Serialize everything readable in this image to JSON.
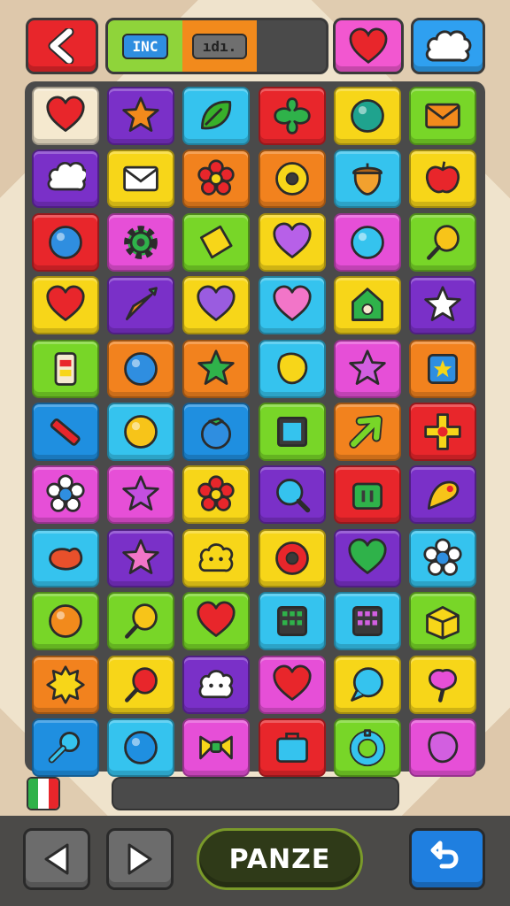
{
  "top_bar": {
    "tab_a_label": "INC",
    "tab_b_label": "ıdı."
  },
  "colors": {
    "red": "#e8262b",
    "orange": "#f2821e",
    "yellow": "#f7d619",
    "green": "#78d628",
    "cyan": "#35c3ee",
    "blue": "#1f8fe0",
    "purple": "#7a30c8",
    "magenta": "#e64fd7",
    "cream": "#f5e9cf"
  },
  "tiles": [
    {
      "bg": "cream",
      "icon": "heart",
      "c": "#e8262b"
    },
    {
      "bg": "purple",
      "icon": "star",
      "c": "#f28a1c"
    },
    {
      "bg": "cyan",
      "icon": "leaf",
      "c": "#38b02a"
    },
    {
      "bg": "red",
      "icon": "clover",
      "c": "#2fb24a"
    },
    {
      "bg": "yellow",
      "icon": "orb",
      "c": "#1fa38e"
    },
    {
      "bg": "green",
      "icon": "envelope",
      "c": "#f28a1c"
    },
    {
      "bg": "purple",
      "icon": "cloud",
      "c": "#ffffff"
    },
    {
      "bg": "yellow",
      "icon": "envelope",
      "c": "#ffffff"
    },
    {
      "bg": "orange",
      "icon": "flower",
      "c": "#e8262b"
    },
    {
      "bg": "orange",
      "icon": "donut",
      "c": "#f7d619"
    },
    {
      "bg": "cyan",
      "icon": "acorn",
      "c": "#f2a12e"
    },
    {
      "bg": "yellow",
      "icon": "apple",
      "c": "#e8262b"
    },
    {
      "bg": "red",
      "icon": "orb",
      "c": "#2f8ee0"
    },
    {
      "bg": "magenta",
      "icon": "gear",
      "c": "#2fb24a"
    },
    {
      "bg": "green",
      "icon": "diamond",
      "c": "#f7d619"
    },
    {
      "bg": "yellow",
      "icon": "heart",
      "c": "#b760e8"
    },
    {
      "bg": "magenta",
      "icon": "orb",
      "c": "#35c3ee"
    },
    {
      "bg": "green",
      "icon": "balloon",
      "c": "#f7c419"
    },
    {
      "bg": "yellow",
      "icon": "heart",
      "c": "#e8262b"
    },
    {
      "bg": "purple",
      "icon": "carrot",
      "c": "#f28a1c"
    },
    {
      "bg": "yellow",
      "icon": "heart",
      "c": "#9a5ce0"
    },
    {
      "bg": "cyan",
      "icon": "heart",
      "c": "#f275c8"
    },
    {
      "bg": "yellow",
      "icon": "house",
      "c": "#2fb24a"
    },
    {
      "bg": "purple",
      "icon": "star",
      "c": "#ffffff"
    },
    {
      "bg": "green",
      "icon": "battery",
      "c": "#f5e9cf"
    },
    {
      "bg": "orange",
      "icon": "orb",
      "c": "#2f8ee0"
    },
    {
      "bg": "orange",
      "icon": "star",
      "c": "#2fb24a"
    },
    {
      "bg": "cyan",
      "icon": "blob",
      "c": "#f7d619"
    },
    {
      "bg": "magenta",
      "icon": "star",
      "c": "#d25fe0"
    },
    {
      "bg": "orange",
      "icon": "badge",
      "c": "#2f8ee0"
    },
    {
      "bg": "blue",
      "icon": "pencil",
      "c": "#e8262b"
    },
    {
      "bg": "cyan",
      "icon": "orb",
      "c": "#f7c419"
    },
    {
      "bg": "blue",
      "icon": "tomato",
      "c": "#2f8ee0"
    },
    {
      "bg": "green",
      "icon": "square",
      "c": "#35c3ee"
    },
    {
      "bg": "orange",
      "icon": "arrow",
      "c": "#78d628"
    },
    {
      "bg": "red",
      "icon": "cross",
      "c": "#f7d619"
    },
    {
      "bg": "magenta",
      "icon": "daisy",
      "c": "#ffffff"
    },
    {
      "bg": "magenta",
      "icon": "star",
      "c": "#c34fe0"
    },
    {
      "bg": "yellow",
      "icon": "flower",
      "c": "#e8262b"
    },
    {
      "bg": "purple",
      "icon": "magnifier",
      "c": "#35c3ee"
    },
    {
      "bg": "red",
      "icon": "bag",
      "c": "#2fb24a"
    },
    {
      "bg": "purple",
      "icon": "bird",
      "c": "#f7c419"
    },
    {
      "bg": "cyan",
      "icon": "bean",
      "c": "#e8502b"
    },
    {
      "bg": "purple",
      "icon": "star",
      "c": "#f275c8"
    },
    {
      "bg": "yellow",
      "icon": "cloudface",
      "c": "#f7d619"
    },
    {
      "bg": "yellow",
      "icon": "donut",
      "c": "#e8262b"
    },
    {
      "bg": "purple",
      "icon": "heart",
      "c": "#2fb24a"
    },
    {
      "bg": "cyan",
      "icon": "daisy",
      "c": "#ffffff"
    },
    {
      "bg": "green",
      "icon": "orb",
      "c": "#f28a1c"
    },
    {
      "bg": "green",
      "icon": "balloon",
      "c": "#f7c419"
    },
    {
      "bg": "green",
      "icon": "heart",
      "c": "#e8262b"
    },
    {
      "bg": "cyan",
      "icon": "dice",
      "c": "#2fb24a"
    },
    {
      "bg": "cyan",
      "icon": "dice",
      "c": "#d25fe0"
    },
    {
      "bg": "green",
      "icon": "box",
      "c": "#f7d619"
    },
    {
      "bg": "orange",
      "icon": "sun",
      "c": "#f7d619"
    },
    {
      "bg": "yellow",
      "icon": "balloon",
      "c": "#e8262b"
    },
    {
      "bg": "purple",
      "icon": "cloudface",
      "c": "#ffffff"
    },
    {
      "bg": "magenta",
      "icon": "heart",
      "c": "#e8262b"
    },
    {
      "bg": "yellow",
      "icon": "bubble",
      "c": "#35c3ee"
    },
    {
      "bg": "yellow",
      "icon": "pin",
      "c": "#e64fd7"
    },
    {
      "bg": "blue",
      "icon": "key",
      "c": "#35c3ee"
    },
    {
      "bg": "cyan",
      "icon": "orb",
      "c": "#1f8fe0"
    },
    {
      "bg": "magenta",
      "icon": "bow",
      "c": "#f7d619"
    },
    {
      "bg": "red",
      "icon": "case",
      "c": "#35c3ee"
    },
    {
      "bg": "green",
      "icon": "ring",
      "c": "#35c3ee"
    },
    {
      "bg": "magenta",
      "icon": "blob",
      "c": "#d25fe0"
    }
  ],
  "footer": {
    "progress_value": 0,
    "flag_colors": [
      "#2fb24a",
      "#ffffff",
      "#e8262b"
    ]
  },
  "controls": {
    "main_button_label": "PANZE"
  }
}
